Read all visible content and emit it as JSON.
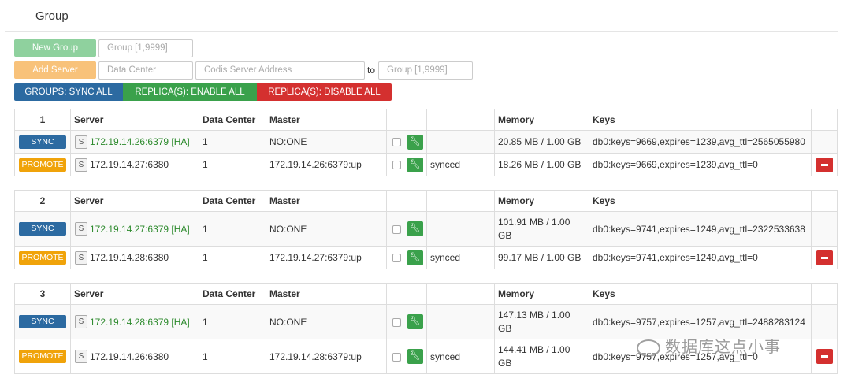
{
  "header": {
    "title": "Group"
  },
  "toolbar": {
    "new_group_label": "New Group",
    "group_input_placeholder": "Group [1,9999]",
    "add_server_label": "Add Server",
    "data_center_placeholder": "Data Center",
    "codis_address_placeholder": "Codis Server Address",
    "to_label": "to",
    "target_group_placeholder": "Group [1,9999]",
    "sync_all_label": "GROUPS: SYNC ALL",
    "enable_label": "REPLICA(S): ENABLE ALL",
    "disable_label": "REPLICA(S): DISABLE ALL"
  },
  "columns": {
    "server": "Server",
    "data_center": "Data Center",
    "master": "Master",
    "memory": "Memory",
    "keys": "Keys"
  },
  "groups": [
    {
      "id": "1",
      "rows": [
        {
          "action": "SYNC",
          "s_label": "S",
          "server": "172.19.14.26:6379 [HA]",
          "dc": "1",
          "master": "NO:ONE",
          "status": "",
          "memory": "20.85 MB / 1.00 GB",
          "keys": "db0:keys=9669,expires=1239,avg_ttl=2565055980"
        },
        {
          "action": "PROMOTE",
          "s_label": "S",
          "server": "172.19.14.27:6380",
          "dc": "1",
          "master": "172.19.14.26:6379:up",
          "status": "synced",
          "memory": "18.26 MB / 1.00 GB",
          "keys": "db0:keys=9669,expires=1239,avg_ttl=0"
        }
      ]
    },
    {
      "id": "2",
      "rows": [
        {
          "action": "SYNC",
          "s_label": "S",
          "server": "172.19.14.27:6379 [HA]",
          "dc": "1",
          "master": "NO:ONE",
          "status": "",
          "memory": "101.91 MB / 1.00 GB",
          "keys": "db0:keys=9741,expires=1249,avg_ttl=2322533638"
        },
        {
          "action": "PROMOTE",
          "s_label": "S",
          "server": "172.19.14.28:6380",
          "dc": "1",
          "master": "172.19.14.27:6379:up",
          "status": "synced",
          "memory": "99.17 MB / 1.00 GB",
          "keys": "db0:keys=9741,expires=1249,avg_ttl=0"
        }
      ]
    },
    {
      "id": "3",
      "rows": [
        {
          "action": "SYNC",
          "s_label": "S",
          "server": "172.19.14.28:6379 [HA]",
          "dc": "1",
          "master": "NO:ONE",
          "status": "",
          "memory": "147.13 MB / 1.00 GB",
          "keys": "db0:keys=9757,expires=1257,avg_ttl=2488283124"
        },
        {
          "action": "PROMOTE",
          "s_label": "S",
          "server": "172.19.14.26:6380",
          "dc": "1",
          "master": "172.19.14.28:6379:up",
          "status": "synced",
          "memory": "144.41 MB / 1.00 GB",
          "keys": "db0:keys=9757,expires=1257,avg_ttl=0"
        }
      ]
    }
  ],
  "watermark": "数据库这点小事",
  "colors": {
    "sync": "#2c6aa1",
    "promote": "#f0a30a",
    "enable": "#3aa14b",
    "disable": "#d4302f",
    "master_text": "#2e8b2e"
  }
}
